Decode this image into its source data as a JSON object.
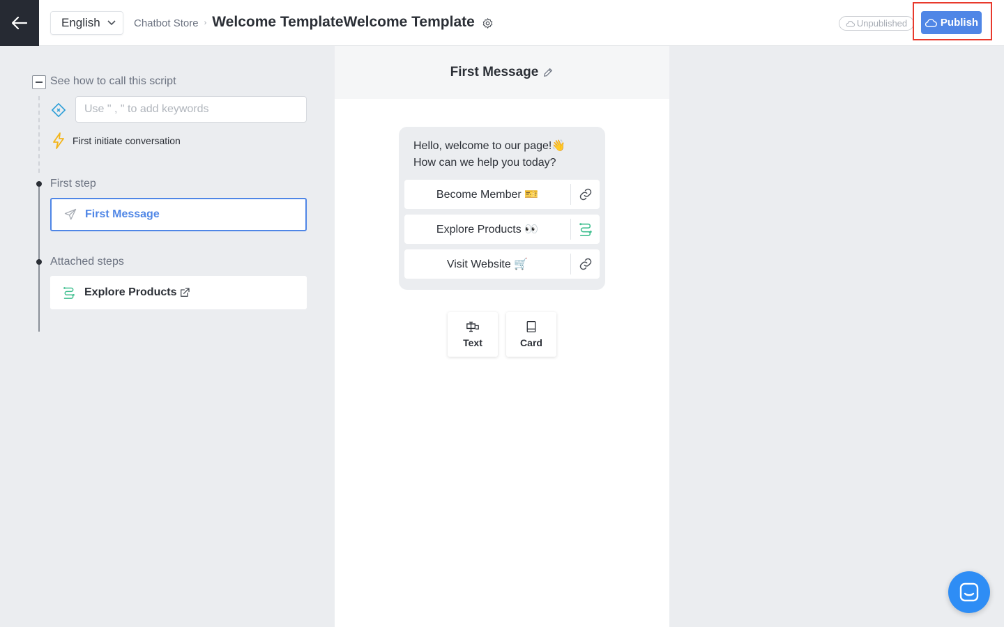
{
  "header": {
    "language": "English",
    "breadcrumb_parent": "Chatbot Store",
    "title": "Welcome TemplateWelcome Template",
    "status": "Unpublished",
    "publish_label": "Publish"
  },
  "sidebar": {
    "call_script_label": "See how to call this script",
    "keyword_placeholder": "Use \" , \" to add keywords",
    "initiate_label": "First initiate conversation",
    "first_step_label": "First step",
    "first_step_item": "First Message",
    "attached_steps_label": "Attached steps",
    "attached_items": [
      "Explore Products"
    ]
  },
  "editor": {
    "title": "First Message",
    "message_line1": "Hello, welcome to our page!👋",
    "message_line2": "How can we help you today?",
    "buttons": [
      {
        "label": "Become Member 🎫",
        "icon": "link-icon"
      },
      {
        "label": "Explore Products 👀",
        "icon": "flow-icon"
      },
      {
        "label": "Visit Website 🛒",
        "icon": "link-icon"
      }
    ],
    "add_options": [
      {
        "label": "Text",
        "icon": "text-icon"
      },
      {
        "label": "Card",
        "icon": "card-icon"
      }
    ]
  },
  "colors": {
    "accent": "#4f86e6",
    "publish_highlight": "#e8392c",
    "flow_green": "#3fbf8f",
    "launcher": "#2e8df5"
  }
}
